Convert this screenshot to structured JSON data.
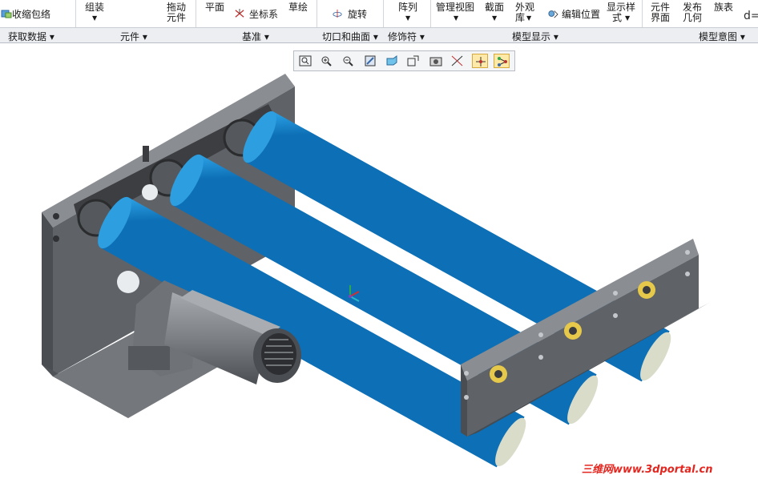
{
  "ribbon": {
    "get_data": {
      "shrinkwrap": "收缩包络"
    },
    "components": {
      "assemble": "组装",
      "drag_line1": "拖动",
      "drag_line2": "元件"
    },
    "datum": {
      "plane": "平面",
      "coord_sys": "坐标系",
      "sketch": "草绘"
    },
    "cut_surface": {
      "revolve": "旋转"
    },
    "modifiers": {
      "pattern": "阵列"
    },
    "model_display": {
      "manage_views": "管理视图",
      "section": "截面",
      "appearance_line1": "外观",
      "appearance_line2": "库",
      "edit_position": "编辑位置",
      "display_style_line1": "显示样",
      "display_style_line2": "式"
    },
    "model_intent": {
      "comp_interface_line1": "元件",
      "comp_interface_line2": "界面",
      "publish_geom_line1": "发布",
      "publish_geom_line2": "几何",
      "family_table": "族表",
      "partial": "d="
    }
  },
  "groups": [
    "获取数据",
    "元件",
    "基准",
    "切口和曲面",
    "修饰符",
    "模型显示",
    "模型意图"
  ],
  "view_toolbar": [
    {
      "name": "refit-icon",
      "active": false
    },
    {
      "name": "zoom-in-icon",
      "active": false
    },
    {
      "name": "zoom-out-icon",
      "active": false
    },
    {
      "name": "repaint-icon",
      "active": false
    },
    {
      "name": "display-style-icon",
      "active": false
    },
    {
      "name": "saved-orientations-icon",
      "active": false
    },
    {
      "name": "view-manager-icon",
      "active": false
    },
    {
      "name": "datum-display-icon",
      "active": false
    },
    {
      "name": "spin-center-icon",
      "active": true
    },
    {
      "name": "annotation-display-icon",
      "active": true
    }
  ],
  "watermark": "三维网www.3dportal.cn",
  "colors": {
    "roller_blue": "#2ea6e8",
    "frame_gray": "#5e6166",
    "motor_gray": "#85888c",
    "bearing_gold": "#e6c84a",
    "watermark_red": "#e3261f"
  }
}
